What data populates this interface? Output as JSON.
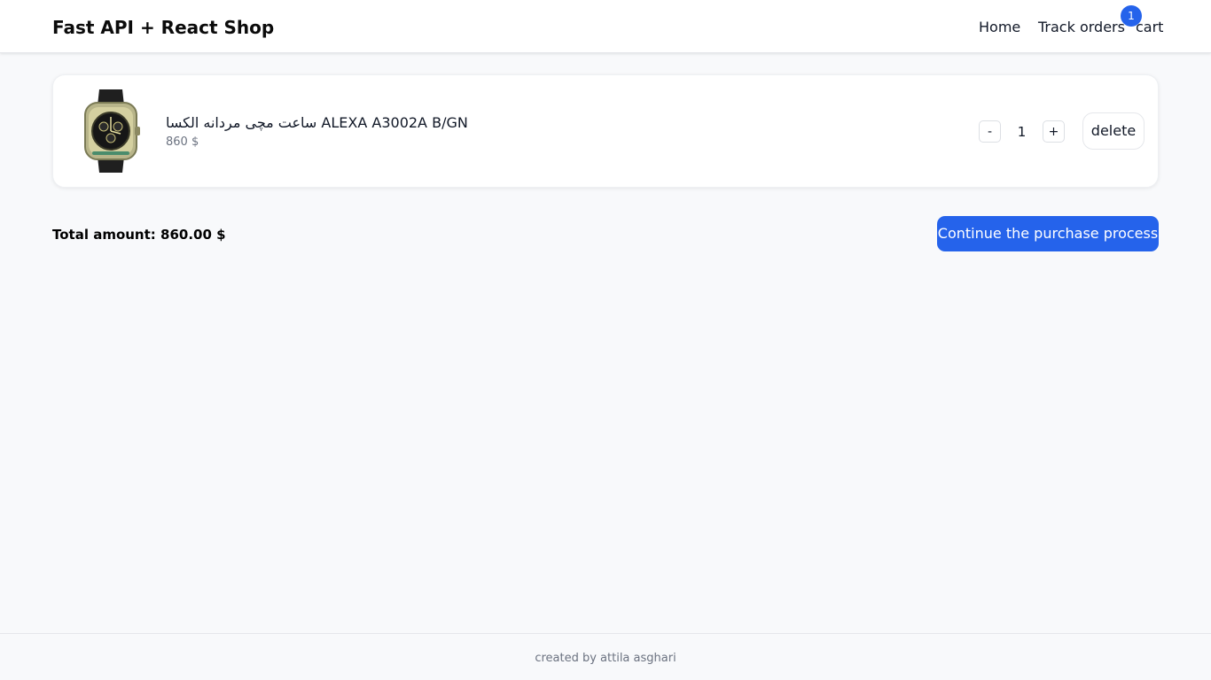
{
  "header": {
    "brand": "Fast API + React Shop",
    "nav": {
      "home": "Home",
      "track_orders": "Track orders",
      "cart": "cart",
      "cart_count": "1"
    }
  },
  "cart": {
    "items": [
      {
        "name": "ساعت مچی مردانه الکسا ALEXA A3002A B/GN",
        "price": "860 $",
        "quantity": "1",
        "minus_label": "-",
        "plus_label": "+",
        "delete_label": "delete"
      }
    ],
    "total_label": "Total amount: 860.00 $",
    "purchase_label": "Continue the purchase process"
  },
  "footer": {
    "text": "created by attila asghari"
  },
  "colors": {
    "accent": "#2563eb",
    "background": "#f8f9fb"
  }
}
